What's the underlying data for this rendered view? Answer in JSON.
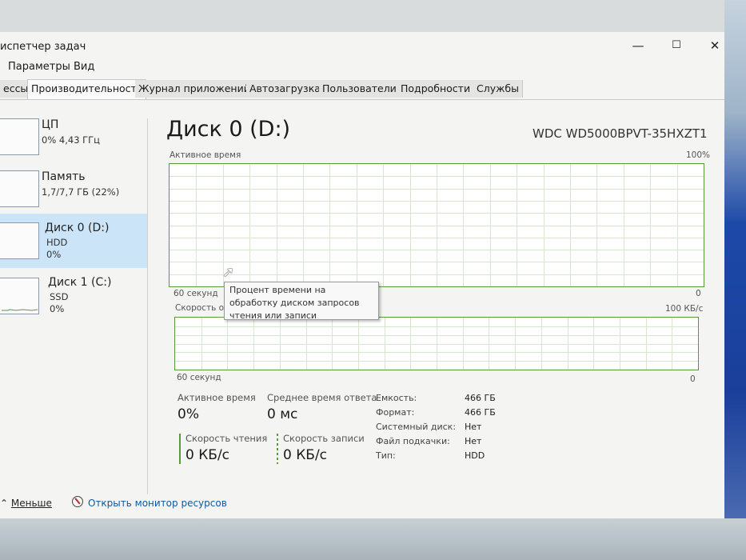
{
  "window": {
    "title": "испетчер задач",
    "controls": {
      "minimize": "—",
      "maximize": "☐",
      "close": "✕"
    }
  },
  "menu": [
    "Параметры",
    "Вид"
  ],
  "tabs": [
    {
      "label": "ессы"
    },
    {
      "label": "Производительность",
      "active": true
    },
    {
      "label": "Журнал приложений"
    },
    {
      "label": "Автозагрузка"
    },
    {
      "label": "Пользователи"
    },
    {
      "label": "Подробности"
    },
    {
      "label": "Службы"
    }
  ],
  "sidebar": [
    {
      "title": "ЦП",
      "line1": "0% 4,43 ГГц",
      "line2": ""
    },
    {
      "title": "Память",
      "line1": "1,7/7,7 ГБ (22%)",
      "line2": ""
    },
    {
      "title": "Диск 0 (D:)",
      "line1": "HDD",
      "line2": "0%",
      "selected": true
    },
    {
      "title": "Диск 1 (C:)",
      "line1": "SSD",
      "line2": "0%"
    }
  ],
  "main": {
    "title": "Диск 0 (D:)",
    "model": "WDC WD5000BPVT-35HXZT1",
    "graph1": {
      "label": "Активное время",
      "max": "100%",
      "time": "60 секунд",
      "min": "0"
    },
    "graph2": {
      "label": "Скорость о",
      "max": "100 КБ/с",
      "time": "60 секунд",
      "min": "0"
    },
    "tooltip": "Процент времени на обработку диском запросов чтения или записи",
    "stats": {
      "active_label": "Активное время",
      "active_value": "0%",
      "response_label": "Среднее время ответа",
      "response_value": "0 мс",
      "read_label": "Скорость чтения",
      "read_value": "0 КБ/с",
      "write_label": "Скорость записи",
      "write_value": "0 КБ/с"
    },
    "properties": [
      {
        "k": "Емкость:",
        "v": "466 ГБ"
      },
      {
        "k": "Формат:",
        "v": "466 ГБ"
      },
      {
        "k": "Системный диск:",
        "v": "Нет"
      },
      {
        "k": "Файл подкачки:",
        "v": "Нет"
      },
      {
        "k": "Тип:",
        "v": "HDD"
      }
    ]
  },
  "footer": {
    "less": "Меньше",
    "monitor": "Открыть монитор ресурсов"
  },
  "colors": {
    "graph_line": "#5a9a3c",
    "selected_bg": "#cce4f7",
    "link": "#0a5aa8"
  }
}
